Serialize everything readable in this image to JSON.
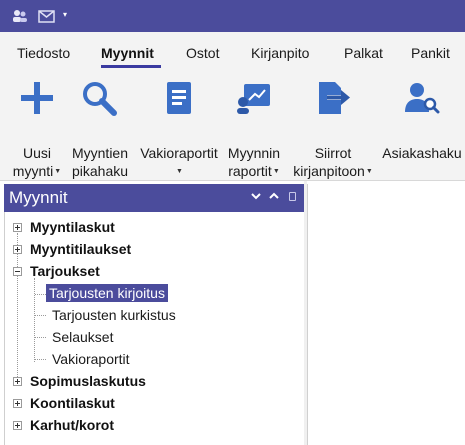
{
  "titlebar": {
    "quick_access_icons": [
      "users-edit-icon",
      "envelope-icon",
      "chevron-down-icon"
    ]
  },
  "ribbon": {
    "tabs": [
      {
        "label": "Tiedosto"
      },
      {
        "label": "Myynnit"
      },
      {
        "label": "Ostot"
      },
      {
        "label": "Kirjanpito"
      },
      {
        "label": "Palkat"
      },
      {
        "label": "Pankit"
      }
    ],
    "active_tab": "Myynnit",
    "buttons": [
      {
        "line1": "Uusi",
        "line2": "myynti",
        "icon": "plus-icon",
        "dropdown": true
      },
      {
        "line1": "Myyntien",
        "line2": "pikahaku",
        "icon": "search-icon",
        "dropdown": false
      },
      {
        "line1": "Vakioraportit",
        "line2": "",
        "icon": "report-icon",
        "dropdown": true
      },
      {
        "line1": "Myynnin",
        "line2": "raportit",
        "icon": "chart-screen-icon",
        "dropdown": true
      },
      {
        "line1": "Siirrot",
        "line2": "kirjanpitoon",
        "icon": "transfer-icon",
        "dropdown": true
      },
      {
        "line1": "Asiakashaku",
        "line2": "",
        "icon": "customer-search-icon",
        "dropdown": false
      }
    ]
  },
  "nav_pane": {
    "title": "Myynnit",
    "tree": [
      {
        "label": "Myyntilaskut",
        "level": 0,
        "expanded": false
      },
      {
        "label": "Myyntitilaukset",
        "level": 0,
        "expanded": false
      },
      {
        "label": "Tarjoukset",
        "level": 0,
        "expanded": true
      },
      {
        "label": "Tarjousten kirjoitus",
        "level": 1,
        "selected": true
      },
      {
        "label": "Tarjousten kurkistus",
        "level": 1
      },
      {
        "label": "Selaukset",
        "level": 1
      },
      {
        "label": "Vakioraportit",
        "level": 1
      },
      {
        "label": "Sopimuslaskutus",
        "level": 0,
        "expanded": false
      },
      {
        "label": "Koontilaskut",
        "level": 0,
        "expanded": false
      },
      {
        "label": "Karhut/korot",
        "level": 0,
        "expanded": false
      }
    ]
  },
  "colors": {
    "accent": "#4b4c9c",
    "icon_blue": "#3b6fc6"
  }
}
